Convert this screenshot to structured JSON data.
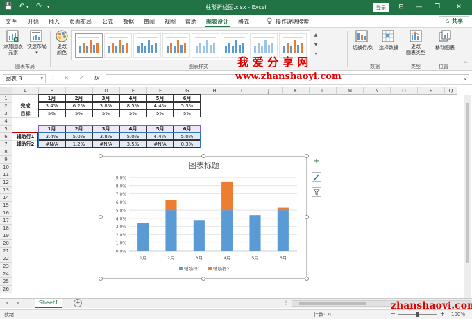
{
  "window": {
    "title": "柱形折线图.xlsx - Excel",
    "login_label": "登录",
    "minimize": "—",
    "restore": "❐",
    "close": "✕",
    "ribbon_options": "⊟"
  },
  "quick_access": {
    "save": "💾",
    "undo": "↶",
    "redo": "↷",
    "more": "▾"
  },
  "menu": {
    "tabs": [
      "文件",
      "开始",
      "插入",
      "页面布局",
      "公式",
      "数据",
      "审阅",
      "视图",
      "帮助",
      "图表设计",
      "格式"
    ],
    "active_tab": "图表设计",
    "tell_me": "操作说明搜索",
    "tell_me_icon": "lightbulb-icon",
    "share_label": "共享",
    "share_icon": "person-icon"
  },
  "ribbon": {
    "add_element": "添加图表\n元素",
    "add_element_arrow": "▾",
    "quick_layout": "快速布局",
    "quick_layout_arrow": "▾",
    "change_colors": "更改\n颜色",
    "change_colors_arrow": "▾",
    "switch_row_col": "切换行/列",
    "select_data": "选择数据",
    "change_type": "更改\n图表类型",
    "move_chart": "移动图表",
    "groups": {
      "layout": "图表布局",
      "styles": "图表样式",
      "data": "数据",
      "type": "类型",
      "location": "位置"
    },
    "collapse": "^"
  },
  "formula_bar": {
    "name_box": "图表 3",
    "name_arrow": "▾",
    "more": "⋮",
    "cancel": "✕",
    "enter": "✓",
    "fx": "fx",
    "value": "",
    "expand": "⌄"
  },
  "grid": {
    "columns": [
      "A",
      "B",
      "C",
      "D",
      "E",
      "F",
      "G",
      "H",
      "I",
      "J",
      "K",
      "L",
      "M",
      "N",
      "O",
      "P",
      "Q"
    ],
    "rows": [
      "1",
      "2",
      "3",
      "4",
      "5",
      "6",
      "7",
      "8",
      "9",
      "10",
      "11",
      "12",
      "13",
      "14",
      "15",
      "16",
      "17",
      "18",
      "19",
      "20",
      "21",
      "22",
      "23",
      "24",
      "25",
      "26"
    ],
    "table1": {
      "headers": [
        "1月",
        "2月",
        "3月",
        "4月",
        "5月",
        "6月"
      ],
      "rows": [
        {
          "label": "完成",
          "values": [
            "3.4%",
            "6.2%",
            "3.8%",
            "8.5%",
            "4.4%",
            "5.3%"
          ]
        },
        {
          "label": "目标",
          "values": [
            "5%",
            "5%",
            "5%",
            "5%",
            "5%",
            "5%"
          ]
        }
      ]
    },
    "table2": {
      "headers": [
        "1月",
        "2月",
        "3月",
        "4月",
        "5月",
        "6月"
      ],
      "rows": [
        {
          "label": "辅助行1",
          "values": [
            "3.4%",
            "5.0%",
            "3.8%",
            "5.0%",
            "4.4%",
            "5.0%"
          ]
        },
        {
          "label": "辅助行2",
          "values": [
            "#N/A",
            "1.2%",
            "#N/A",
            "3.5%",
            "#N/A",
            "0.3%"
          ]
        }
      ]
    }
  },
  "chart_data": {
    "type": "bar",
    "stacked": true,
    "title": "图表标题",
    "categories": [
      "1月",
      "2月",
      "3月",
      "4月",
      "5月",
      "6月"
    ],
    "series": [
      {
        "name": "辅助行1",
        "color": "#5b9bd5",
        "values": [
          3.4,
          5.0,
          3.8,
          5.0,
          4.4,
          5.0
        ]
      },
      {
        "name": "辅助行2",
        "color": "#ed7d31",
        "values": [
          0,
          1.2,
          0,
          3.5,
          0,
          0.3
        ]
      }
    ],
    "ylim": [
      0,
      9
    ],
    "yticks": [
      "0.0%",
      "1.0%",
      "2.0%",
      "3.0%",
      "4.0%",
      "5.0%",
      "6.0%",
      "7.0%",
      "8.0%",
      "9.0%"
    ],
    "grid": true,
    "legend": "bottom"
  },
  "chart_tools": {
    "add": "+",
    "style": "brush-icon",
    "filter": "filter-icon"
  },
  "sheet_tabs": {
    "prev": "◂",
    "next": "▸",
    "active": "Sheet1",
    "add": "+",
    "more": "⋮"
  },
  "status": {
    "left": "就绪",
    "count": "计数: 20",
    "zoom": "100%",
    "zoom_out": "−",
    "zoom_in": "+"
  },
  "watermark": {
    "top": "我 爱 分 享 网",
    "url": "www.zhanshaoyi.com",
    "bottom": "zhanshaoyi.com"
  }
}
